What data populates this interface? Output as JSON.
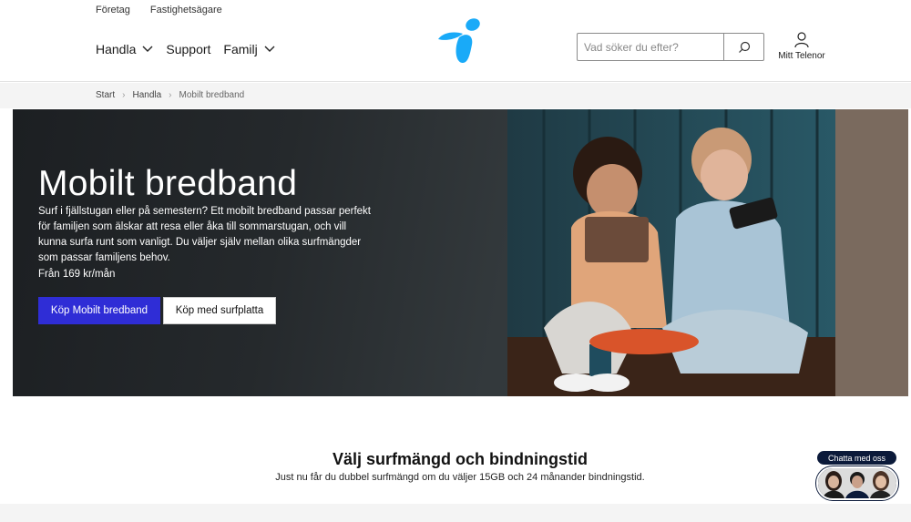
{
  "utility_links": [
    "Företag",
    "Fastighetsägare"
  ],
  "nav": {
    "shop": "Handla",
    "support": "Support",
    "family": "Familj"
  },
  "search": {
    "placeholder": "Vad söker du efter?"
  },
  "account": {
    "label": "Mitt Telenor"
  },
  "breadcrumb": [
    "Start",
    "Handla",
    "Mobilt bredband"
  ],
  "hero": {
    "title": "Mobilt bredband",
    "description": "Surf i fjällstugan eller på semestern? Ett mobilt bredband passar perfekt för familjen som älskar att resa eller åka till sommarstugan, och vill kunna surfa runt som vanligt. Du väljer själv mellan olika surfmängder som passar familjens behov.",
    "price": "Från 169 kr/mån",
    "primary_button": "Köp Mobilt bredband",
    "secondary_button": "Köp med surfplatta"
  },
  "section": {
    "title": "Välj surfmängd och bindningstid",
    "subtitle": "Just nu får du dubbel surfmängd om du väljer 15GB och 24 månander bindningstid."
  },
  "chat": {
    "label": "Chatta med oss"
  },
  "colors": {
    "brand_blue": "#19aaf8",
    "cta": "#2f2dd6",
    "chat_navy": "#0b1a3a"
  }
}
